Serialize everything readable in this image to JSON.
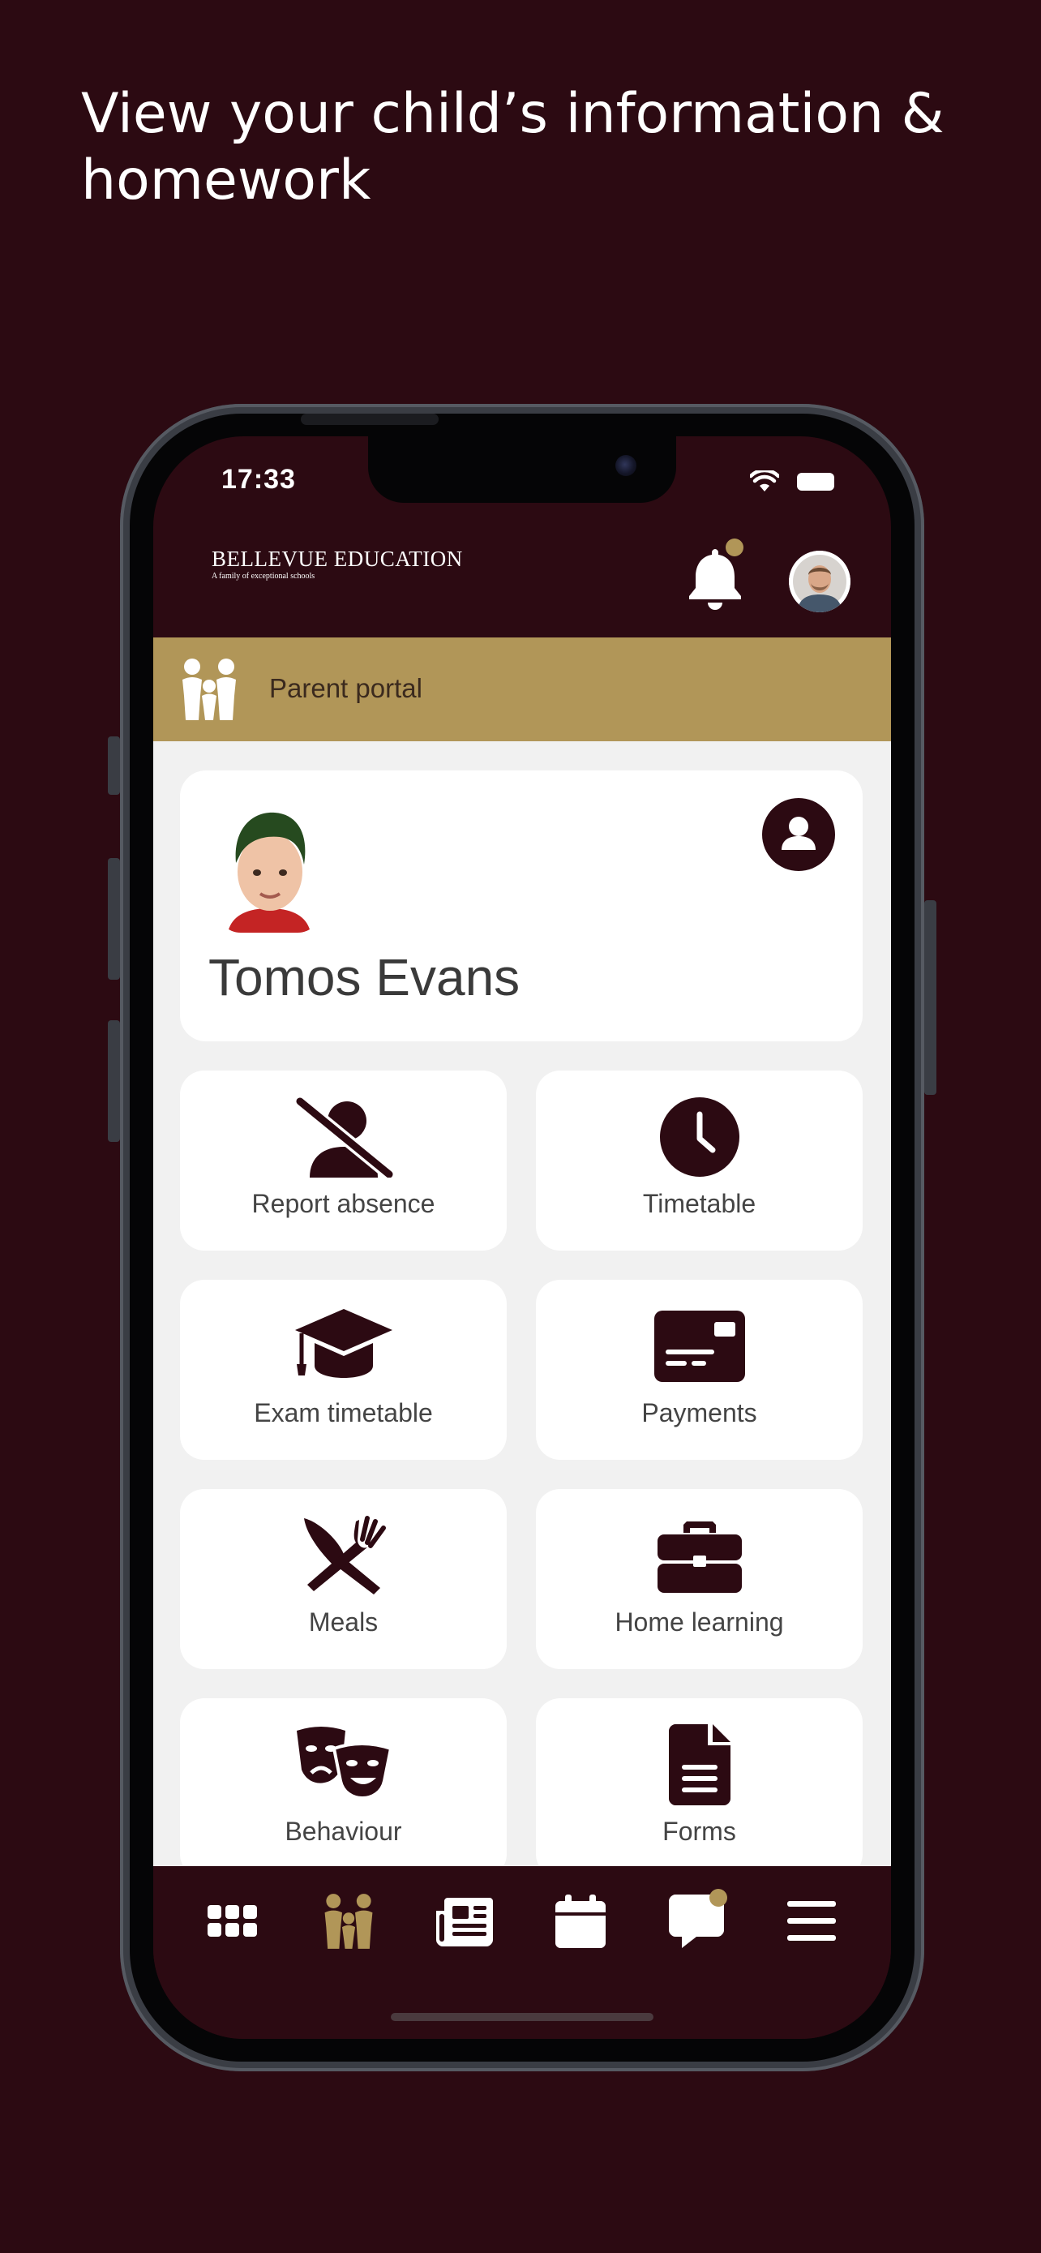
{
  "headline": "View your child’s information & homework",
  "status_bar": {
    "time": "17:33"
  },
  "header": {
    "logo_title": "BELLEVUE EDUCATION",
    "logo_tagline": "A family of exceptional schools",
    "icons": [
      "bell-icon",
      "avatar"
    ]
  },
  "portal": {
    "label": "Parent portal",
    "icon": "family-icon"
  },
  "child": {
    "name": "Tomos Evans",
    "profile_icon": "user-circle-icon"
  },
  "tiles": [
    {
      "label": "Report absence",
      "icon": "user-slash-icon"
    },
    {
      "label": "Timetable",
      "icon": "clock-icon"
    },
    {
      "label": "Exam timetable",
      "icon": "graduation-cap-icon"
    },
    {
      "label": "Payments",
      "icon": "credit-card-icon"
    },
    {
      "label": "Meals",
      "icon": "utensils-icon"
    },
    {
      "label": "Home learning",
      "icon": "briefcase-icon"
    },
    {
      "label": "Behaviour",
      "icon": "masks-icon"
    },
    {
      "label": "Forms",
      "icon": "document-icon"
    }
  ],
  "tabbar": {
    "items": [
      "grid-icon",
      "family-icon",
      "newspaper-icon",
      "calendar-icon",
      "chat-icon",
      "menu-icon"
    ],
    "active": "family-icon"
  },
  "colors": {
    "brand": "#2c0a12",
    "accent": "#b19658",
    "surface": "#f1f1f1"
  }
}
